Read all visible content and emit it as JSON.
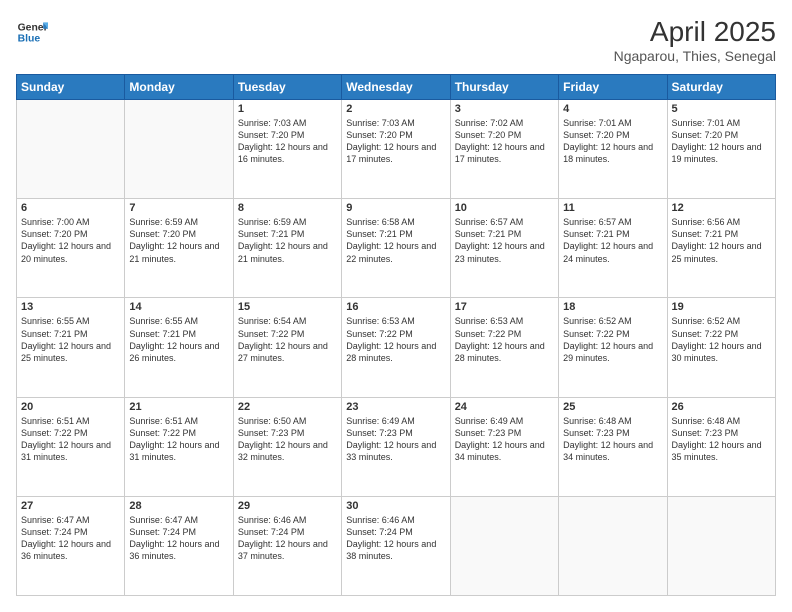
{
  "header": {
    "logo_line1": "General",
    "logo_line2": "Blue",
    "title": "April 2025",
    "subtitle": "Ngaparou, Thies, Senegal"
  },
  "days_of_week": [
    "Sunday",
    "Monday",
    "Tuesday",
    "Wednesday",
    "Thursday",
    "Friday",
    "Saturday"
  ],
  "weeks": [
    [
      {
        "day": "",
        "empty": true
      },
      {
        "day": "",
        "empty": true
      },
      {
        "day": "1",
        "sunrise": "7:03 AM",
        "sunset": "7:20 PM",
        "daylight": "12 hours and 16 minutes."
      },
      {
        "day": "2",
        "sunrise": "7:03 AM",
        "sunset": "7:20 PM",
        "daylight": "12 hours and 17 minutes."
      },
      {
        "day": "3",
        "sunrise": "7:02 AM",
        "sunset": "7:20 PM",
        "daylight": "12 hours and 17 minutes."
      },
      {
        "day": "4",
        "sunrise": "7:01 AM",
        "sunset": "7:20 PM",
        "daylight": "12 hours and 18 minutes."
      },
      {
        "day": "5",
        "sunrise": "7:01 AM",
        "sunset": "7:20 PM",
        "daylight": "12 hours and 19 minutes."
      }
    ],
    [
      {
        "day": "6",
        "sunrise": "7:00 AM",
        "sunset": "7:20 PM",
        "daylight": "12 hours and 20 minutes."
      },
      {
        "day": "7",
        "sunrise": "6:59 AM",
        "sunset": "7:20 PM",
        "daylight": "12 hours and 21 minutes."
      },
      {
        "day": "8",
        "sunrise": "6:59 AM",
        "sunset": "7:21 PM",
        "daylight": "12 hours and 21 minutes."
      },
      {
        "day": "9",
        "sunrise": "6:58 AM",
        "sunset": "7:21 PM",
        "daylight": "12 hours and 22 minutes."
      },
      {
        "day": "10",
        "sunrise": "6:57 AM",
        "sunset": "7:21 PM",
        "daylight": "12 hours and 23 minutes."
      },
      {
        "day": "11",
        "sunrise": "6:57 AM",
        "sunset": "7:21 PM",
        "daylight": "12 hours and 24 minutes."
      },
      {
        "day": "12",
        "sunrise": "6:56 AM",
        "sunset": "7:21 PM",
        "daylight": "12 hours and 25 minutes."
      }
    ],
    [
      {
        "day": "13",
        "sunrise": "6:55 AM",
        "sunset": "7:21 PM",
        "daylight": "12 hours and 25 minutes."
      },
      {
        "day": "14",
        "sunrise": "6:55 AM",
        "sunset": "7:21 PM",
        "daylight": "12 hours and 26 minutes."
      },
      {
        "day": "15",
        "sunrise": "6:54 AM",
        "sunset": "7:22 PM",
        "daylight": "12 hours and 27 minutes."
      },
      {
        "day": "16",
        "sunrise": "6:53 AM",
        "sunset": "7:22 PM",
        "daylight": "12 hours and 28 minutes."
      },
      {
        "day": "17",
        "sunrise": "6:53 AM",
        "sunset": "7:22 PM",
        "daylight": "12 hours and 28 minutes."
      },
      {
        "day": "18",
        "sunrise": "6:52 AM",
        "sunset": "7:22 PM",
        "daylight": "12 hours and 29 minutes."
      },
      {
        "day": "19",
        "sunrise": "6:52 AM",
        "sunset": "7:22 PM",
        "daylight": "12 hours and 30 minutes."
      }
    ],
    [
      {
        "day": "20",
        "sunrise": "6:51 AM",
        "sunset": "7:22 PM",
        "daylight": "12 hours and 31 minutes."
      },
      {
        "day": "21",
        "sunrise": "6:51 AM",
        "sunset": "7:22 PM",
        "daylight": "12 hours and 31 minutes."
      },
      {
        "day": "22",
        "sunrise": "6:50 AM",
        "sunset": "7:23 PM",
        "daylight": "12 hours and 32 minutes."
      },
      {
        "day": "23",
        "sunrise": "6:49 AM",
        "sunset": "7:23 PM",
        "daylight": "12 hours and 33 minutes."
      },
      {
        "day": "24",
        "sunrise": "6:49 AM",
        "sunset": "7:23 PM",
        "daylight": "12 hours and 34 minutes."
      },
      {
        "day": "25",
        "sunrise": "6:48 AM",
        "sunset": "7:23 PM",
        "daylight": "12 hours and 34 minutes."
      },
      {
        "day": "26",
        "sunrise": "6:48 AM",
        "sunset": "7:23 PM",
        "daylight": "12 hours and 35 minutes."
      }
    ],
    [
      {
        "day": "27",
        "sunrise": "6:47 AM",
        "sunset": "7:24 PM",
        "daylight": "12 hours and 36 minutes."
      },
      {
        "day": "28",
        "sunrise": "6:47 AM",
        "sunset": "7:24 PM",
        "daylight": "12 hours and 36 minutes."
      },
      {
        "day": "29",
        "sunrise": "6:46 AM",
        "sunset": "7:24 PM",
        "daylight": "12 hours and 37 minutes."
      },
      {
        "day": "30",
        "sunrise": "6:46 AM",
        "sunset": "7:24 PM",
        "daylight": "12 hours and 38 minutes."
      },
      {
        "day": "",
        "empty": true
      },
      {
        "day": "",
        "empty": true
      },
      {
        "day": "",
        "empty": true
      }
    ]
  ],
  "labels": {
    "sunrise_prefix": "Sunrise: ",
    "sunset_prefix": "Sunset: ",
    "daylight_prefix": "Daylight: "
  }
}
